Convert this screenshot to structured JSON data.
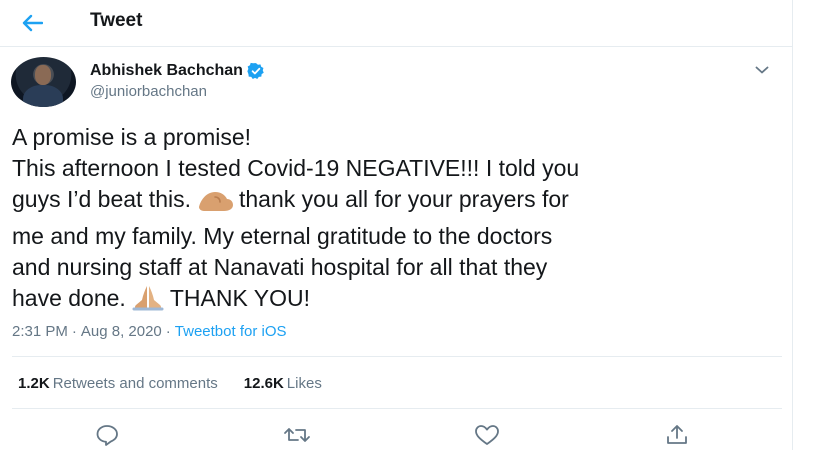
{
  "header": {
    "title": "Tweet",
    "back_icon": "arrow-left-icon"
  },
  "tweet": {
    "author": {
      "name": "Abhishek Bachchan",
      "handle": "@juniorbachchan",
      "verified": true
    },
    "text_lines": [
      "A promise is a promise!",
      "This afternoon I tested Covid-19 NEGATIVE!!! I told you",
      "guys I’d beat this.",
      "thank you all for your prayers for",
      "me and my family. My eternal gratitude to the doctors",
      "and nursing staff at Nanavati hospital for all that they",
      "have done.",
      "THANK YOU!"
    ],
    "emojis": [
      "flexed-biceps",
      "folded-hands"
    ],
    "time": "2:31 PM",
    "separator": "·",
    "date": "Aug 8, 2020",
    "source": "Tweetbot for iOS"
  },
  "stats": {
    "retweets_count": "1.2K",
    "retweets_label": "Retweets and comments",
    "likes_count": "12.6K",
    "likes_label": "Likes"
  },
  "actions": {
    "icons": [
      "reply-icon",
      "retweet-icon",
      "like-icon",
      "share-icon"
    ]
  },
  "colors": {
    "accent": "#1da1f2",
    "text": "#14171a",
    "muted": "#657786",
    "border": "#e6ecf0"
  }
}
